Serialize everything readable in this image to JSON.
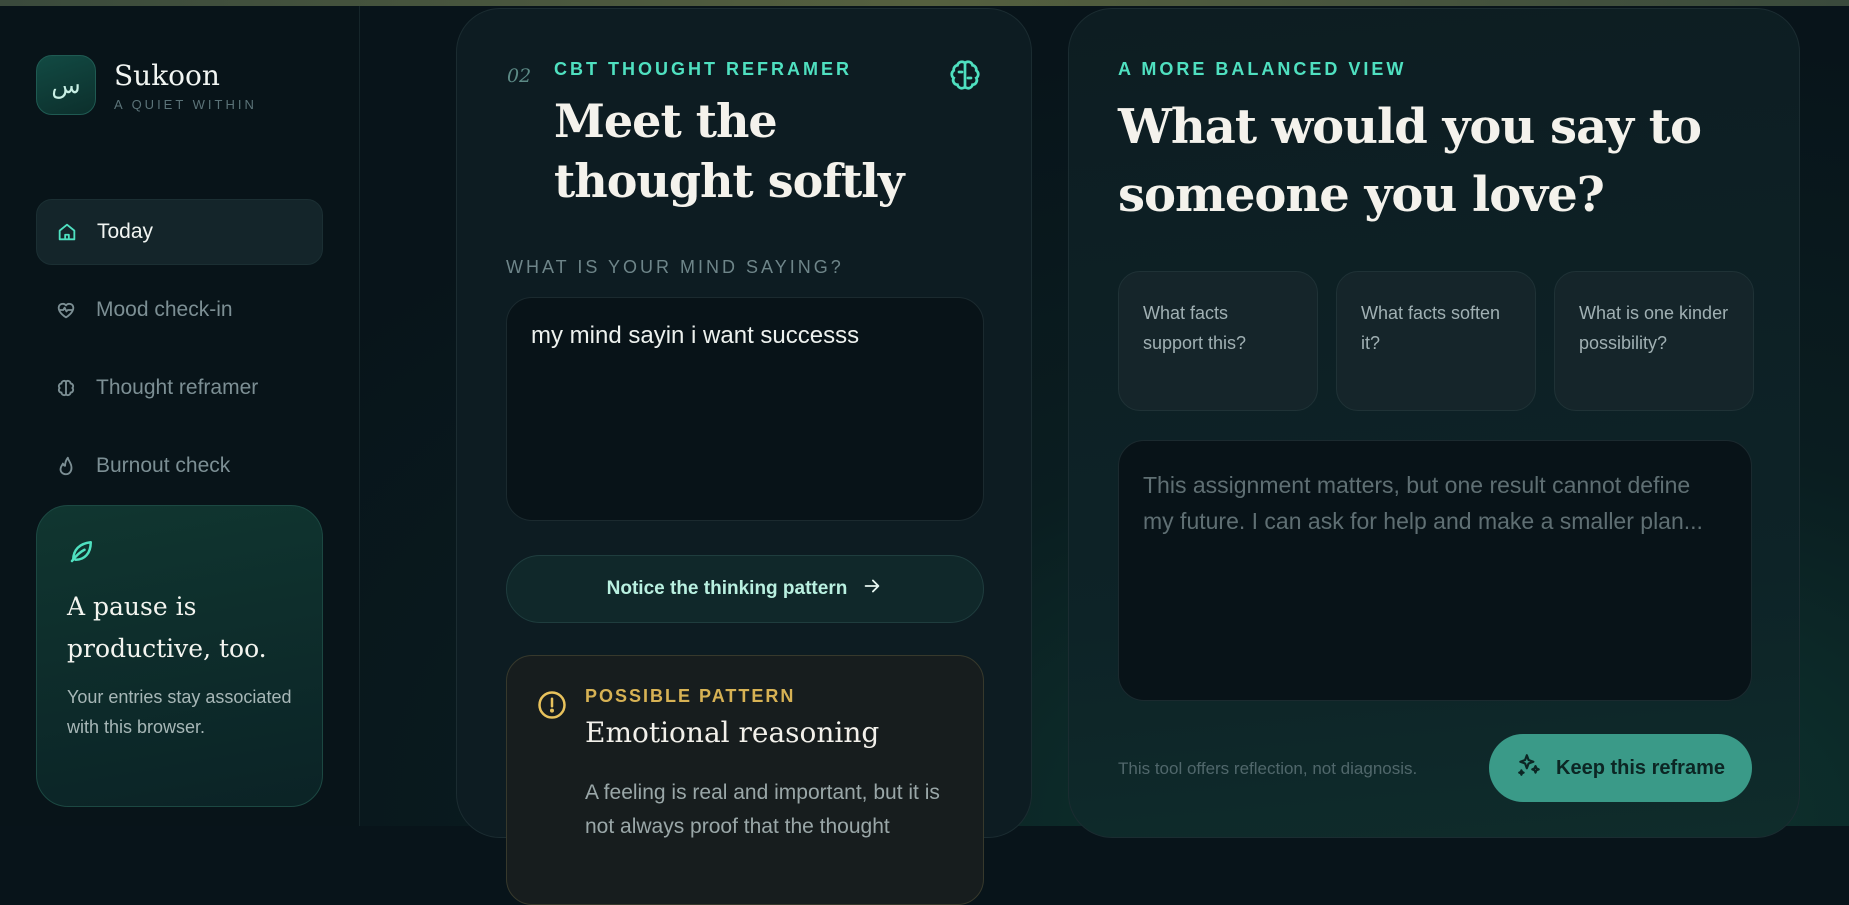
{
  "brand": {
    "logo_glyph": "س",
    "name": "Sukoon",
    "tagline": "A QUIET WITHIN"
  },
  "sidebar": {
    "items": [
      {
        "label": "Today",
        "icon": "home-icon",
        "active": true
      },
      {
        "label": "Mood check-in",
        "icon": "heart-pulse-icon",
        "active": false
      },
      {
        "label": "Thought reframer",
        "icon": "brain-icon",
        "active": false
      },
      {
        "label": "Burnout check",
        "icon": "flame-icon",
        "active": false
      }
    ],
    "pause_card": {
      "icon": "leaf-icon",
      "title": "A pause is productive, too.",
      "description": "Your entries stay associated with this browser."
    }
  },
  "reframer": {
    "step": "02",
    "eyebrow": "CBT THOUGHT REFRAMER",
    "title": "Meet the thought softly",
    "mind_label": "WHAT IS YOUR MIND SAYING?",
    "mind_value": "my mind sayin i want successs",
    "notice_button": "Notice the thinking pattern",
    "pattern": {
      "eyebrow": "POSSIBLE PATTERN",
      "title": "Emotional reasoning",
      "description": "A feeling is real and important, but it is not always proof that the thought"
    }
  },
  "balanced": {
    "eyebrow": "A MORE BALANCED VIEW",
    "title": "What would you say to someone you love?",
    "prompts": [
      "What facts support this?",
      "What facts soften it?",
      "What is one kinder possibility?"
    ],
    "reframe_placeholder": "This assignment matters, but one result cannot define my future. I can ask for help and make a smaller plan...",
    "disclaimer": "This tool offers reflection, not diagnosis.",
    "keep_button": "Keep this reframe"
  },
  "colors": {
    "accent": "#4fe0c0",
    "warning": "#d7b254",
    "primary_button": "#3a9a88"
  }
}
